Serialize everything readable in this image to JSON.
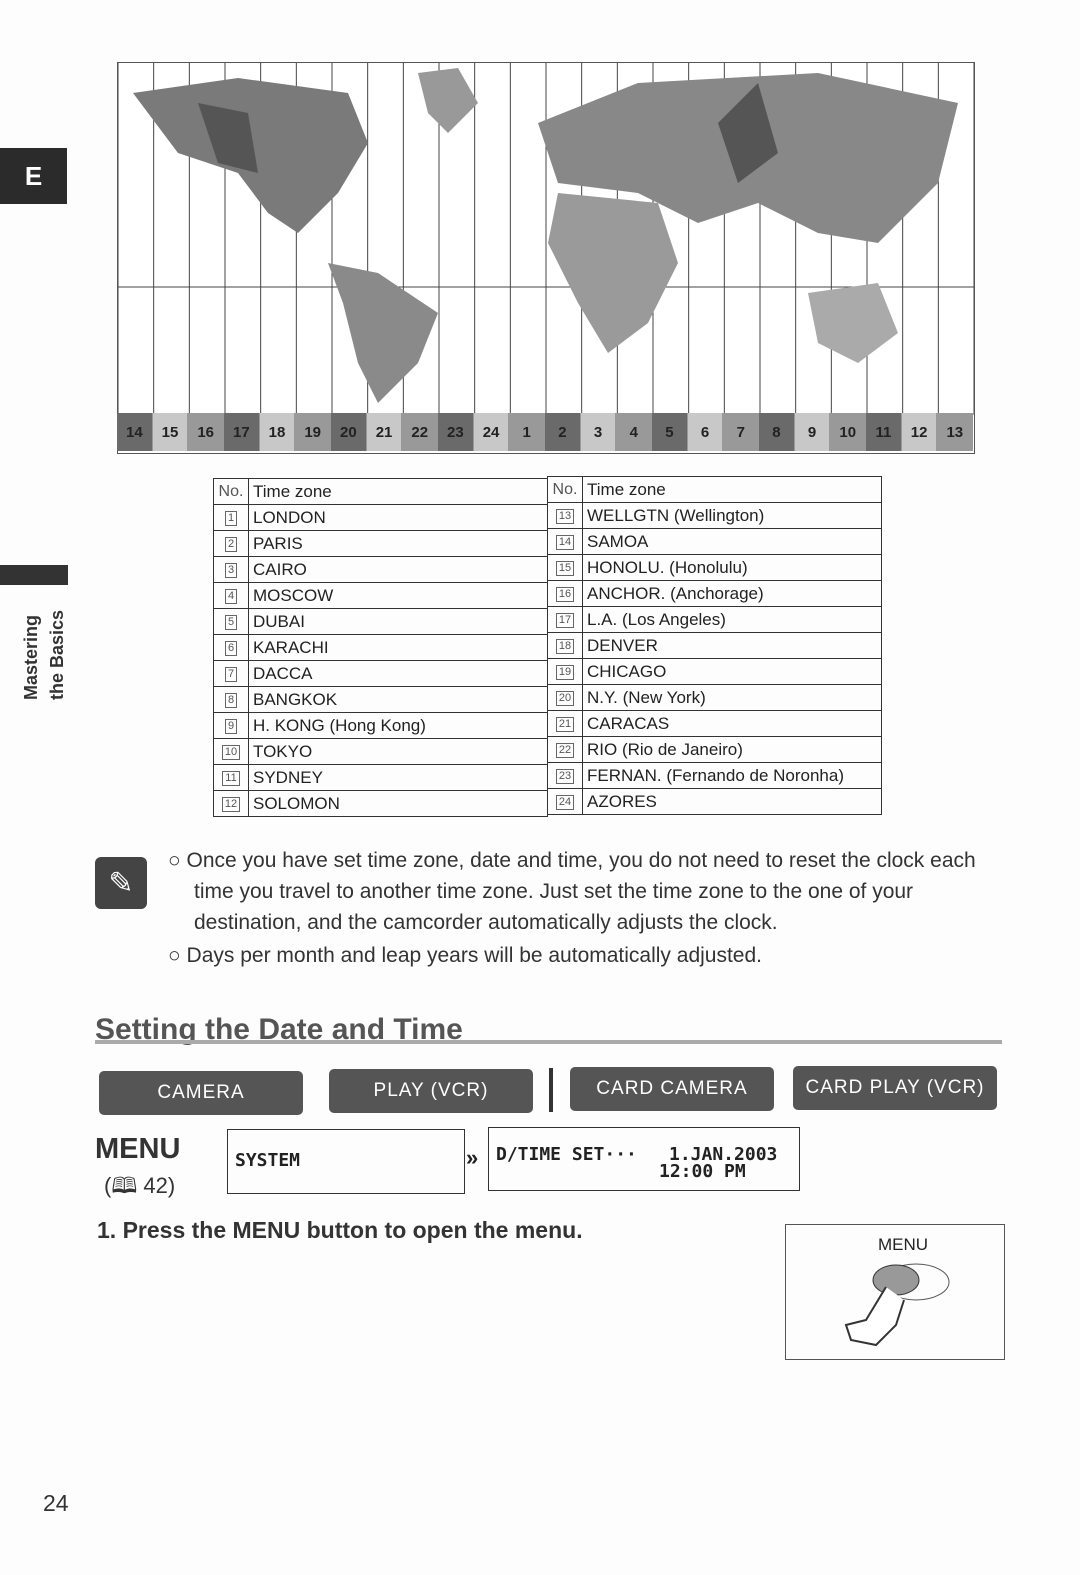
{
  "sidebar": {
    "tab_letter": "E",
    "section": [
      "Mastering",
      "the Basics"
    ]
  },
  "map": {
    "zone_bar": [
      "14",
      "15",
      "16",
      "17",
      "18",
      "19",
      "20",
      "21",
      "22",
      "23",
      "24",
      "1",
      "2",
      "3",
      "4",
      "5",
      "6",
      "7",
      "8",
      "9",
      "10",
      "11",
      "12",
      "13"
    ],
    "zone_shades": [
      "#6a6a6a",
      "#c8c8c8",
      "#999999"
    ]
  },
  "table": {
    "header_no": "No.",
    "header_zone": "Time zone",
    "left": [
      {
        "no": "1",
        "zone": "LONDON"
      },
      {
        "no": "2",
        "zone": "PARIS"
      },
      {
        "no": "3",
        "zone": "CAIRO"
      },
      {
        "no": "4",
        "zone": "MOSCOW"
      },
      {
        "no": "5",
        "zone": "DUBAI"
      },
      {
        "no": "6",
        "zone": "KARACHI"
      },
      {
        "no": "7",
        "zone": "DACCA"
      },
      {
        "no": "8",
        "zone": "BANGKOK"
      },
      {
        "no": "9",
        "zone": "H. KONG (Hong Kong)"
      },
      {
        "no": "10",
        "zone": "TOKYO"
      },
      {
        "no": "11",
        "zone": "SYDNEY"
      },
      {
        "no": "12",
        "zone": "SOLOMON"
      }
    ],
    "right": [
      {
        "no": "13",
        "zone": "WELLGTN (Wellington)"
      },
      {
        "no": "14",
        "zone": "SAMOA"
      },
      {
        "no": "15",
        "zone": "HONOLU. (Honolulu)"
      },
      {
        "no": "16",
        "zone": "ANCHOR. (Anchorage)"
      },
      {
        "no": "17",
        "zone": "L.A. (Los Angeles)"
      },
      {
        "no": "18",
        "zone": "DENVER"
      },
      {
        "no": "19",
        "zone": "CHICAGO"
      },
      {
        "no": "20",
        "zone": "N.Y. (New York)"
      },
      {
        "no": "21",
        "zone": "CARACAS"
      },
      {
        "no": "22",
        "zone": "RIO (Rio de Janeiro)"
      },
      {
        "no": "23",
        "zone": "FERNAN. (Fernando de Noronha)"
      },
      {
        "no": "24",
        "zone": "AZORES"
      }
    ]
  },
  "notes": [
    "Once you have set time zone, date and time, you do not need to reset the clock each time you travel to another time zone. Just set the time zone to the one of your destination, and the camcorder automatically adjusts the clock.",
    "Days per month and leap years will be automatically adjusted."
  ],
  "section_title": "Setting the Date and Time",
  "modes": [
    "CAMERA",
    "PLAY (VCR)",
    "CARD CAMERA",
    "CARD PLAY (VCR)"
  ],
  "menu": {
    "label": "MENU",
    "ref": "(🕮 42)",
    "system": "SYSTEM",
    "item": "D/TIME SET···",
    "date": "1.JAN.2003",
    "time": "12:00 PM"
  },
  "step1": "1. Press the MENU button to open the menu.",
  "figure": {
    "button_label": "MENU"
  },
  "page_number": "24"
}
